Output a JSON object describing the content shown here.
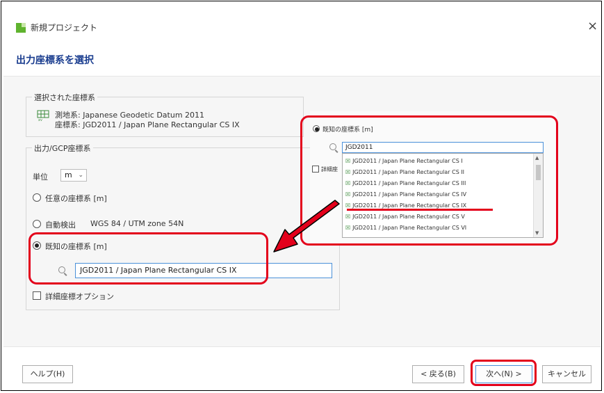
{
  "window": {
    "title": "新規プロジェクト",
    "close_glyph": "×"
  },
  "heading": "出力座標系を選択",
  "selected_crs": {
    "legend": "選択された座標系",
    "datum_line": "測地系: Japanese Geodetic Datum 2011",
    "crs_line": "座標系: JGD2011 / Japan Plane Rectangular CS IX",
    "icon": "grid-icon"
  },
  "output_crs": {
    "legend": "出力/GCP座標系",
    "unit_label": "単位",
    "unit_value": "m",
    "options": [
      {
        "label": "任意の座標系 [m]",
        "detail": "",
        "selected": false
      },
      {
        "label": "自動検出",
        "detail": "WGS 84 / UTM zone 54N",
        "selected": false
      },
      {
        "label": "既知の座標系 [m]",
        "detail": "",
        "selected": true
      }
    ],
    "search_value": "JGD2011 / Japan Plane Rectangular CS IX",
    "advanced_label": "詳細座標オプション"
  },
  "popup": {
    "radio_label": "既知の座標系 [m]",
    "search_value": "JGD2011",
    "checkbox_label": "詳細座",
    "items": [
      "JGD2011 / Japan Plane Rectangular CS I",
      "JGD2011 / Japan Plane Rectangular CS II",
      "JGD2011 / Japan Plane Rectangular CS III",
      "JGD2011 / Japan Plane Rectangular CS IV",
      "JGD2011 / Japan Plane Rectangular CS IX",
      "JGD2011 / Japan Plane Rectangular CS V",
      "JGD2011 / Japan Plane Rectangular CS VI"
    ],
    "highlighted_index": 4
  },
  "footer": {
    "help": "ヘルプ(H)",
    "back": "< 戻る(B)",
    "next": "次へ(N) >",
    "cancel": "キャンセル"
  },
  "colors": {
    "annotation_red": "#e3001b",
    "heading_blue": "#1a3d8f",
    "accent_blue": "#4a90d9"
  }
}
